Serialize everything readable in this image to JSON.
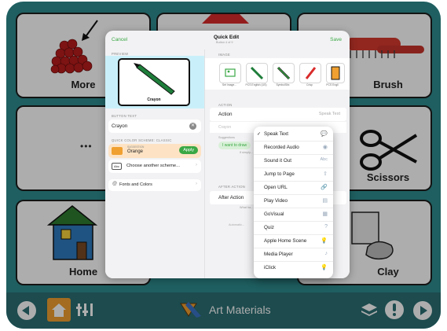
{
  "grid": {
    "more_label": "More",
    "brush_label": "Brush",
    "scissors_label": "Scissors",
    "home_label": "Home",
    "clay_label": "Clay",
    "dots": "•••"
  },
  "bottom_bar": {
    "folder_title": "Art Materials"
  },
  "sheet": {
    "cancel": "Cancel",
    "title": "Quick Edit",
    "subtitle": "Button 4 of 9",
    "save": "Save",
    "preview_section": "PREVIEW",
    "preview_caption": "Crayon",
    "button_text_section": "BUTTON TEXT",
    "button_text_value": "Crayon",
    "color_scheme_section": "QUICK COLOR SCHEME: CLASSIC",
    "suggestion_small": "SUGGESTION",
    "suggestion_name": "Orange",
    "apply": "Apply",
    "abc_badge": "Abc",
    "choose_scheme": "Choose another scheme...",
    "fonts_colors": "Fonts and Colors",
    "image_section": "IMAGE",
    "image_labels": [
      "Set Image...",
      "PCS English (US)",
      "SymbolStix",
      "Crisp",
      "PCS Engli"
    ],
    "action_section": "ACTION",
    "action_label": "Action",
    "action_value": "Speak Text",
    "crayon_placeholder": "Crayon",
    "suggestions": "Suggestions",
    "suggestion_chip": "I want to draw",
    "simply_hint": "If simply...",
    "after_action_section": "AFTER ACTION",
    "after_action_label": "After Action",
    "what_hint": "What ha...",
    "auto_hint": "Automatic..."
  },
  "popup": {
    "items": [
      {
        "label": "Speak Text",
        "icon": "💬",
        "checked": "✓"
      },
      {
        "label": "Recorded Audio",
        "icon": "◉",
        "checked": ""
      },
      {
        "label": "Sound it Out",
        "icon": "Abc",
        "checked": ""
      },
      {
        "label": "Jump to Page",
        "icon": "⇧",
        "checked": ""
      },
      {
        "label": "Open URL",
        "icon": "🔗",
        "checked": ""
      },
      {
        "label": "Play Video",
        "icon": "▤",
        "checked": ""
      },
      {
        "label": "GoVisual",
        "icon": "▦",
        "checked": ""
      },
      {
        "label": "Quiz",
        "icon": "?",
        "checked": ""
      },
      {
        "label": "Apple Home Scene",
        "icon": "💡",
        "checked": ""
      },
      {
        "label": "Media Player",
        "icon": "♪",
        "checked": ""
      },
      {
        "label": "iClick",
        "icon": "💡",
        "checked": ""
      }
    ]
  },
  "colors": {
    "accent_green": "#3aa845",
    "teal_background": "#2f8c8f",
    "bottom_bar": "#2b6f74",
    "home_button": "#f0a030",
    "preview_highlight": "#c9f0fa",
    "suggestion_orange": "#fde3c4"
  }
}
